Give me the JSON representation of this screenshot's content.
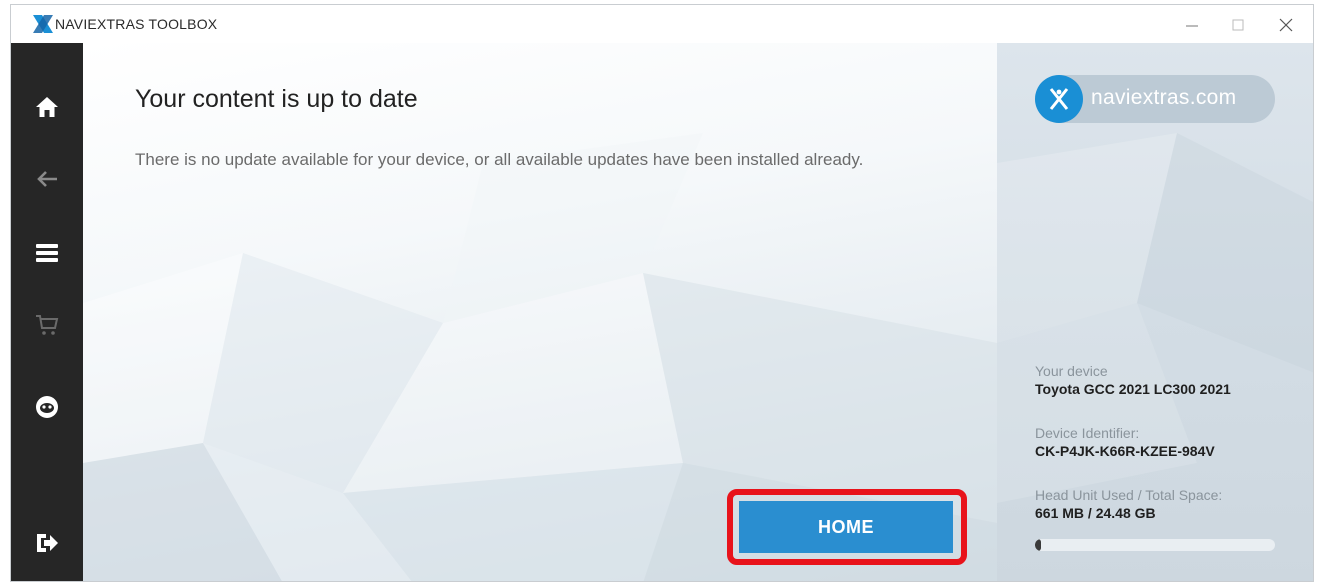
{
  "window": {
    "title": "NAVIEXTRAS TOOLBOX",
    "controls": {
      "minimize": "minimize-icon",
      "maximize": "maximize-icon",
      "close": "close-icon"
    }
  },
  "sidebar": {
    "items": [
      {
        "name": "home",
        "icon": "home-icon"
      },
      {
        "name": "back",
        "icon": "arrow-left-icon"
      },
      {
        "name": "menu",
        "icon": "menu-icon"
      },
      {
        "name": "cart",
        "icon": "cart-icon"
      },
      {
        "name": "profile",
        "icon": "face-icon"
      },
      {
        "name": "logout",
        "icon": "logout-icon"
      }
    ]
  },
  "main": {
    "heading": "Your content is up to date",
    "description": "There is no update available for your device, or all available updates have been installed already.",
    "home_button_label": "HOME"
  },
  "panel": {
    "brand_text": "naviextras.com",
    "device_label": "Your device",
    "device_value": "Toyota GCC 2021 LC300 2021",
    "identifier_label": "Device Identifier:",
    "identifier_value": "CK-P4JK-K66R-KZEE-984V",
    "space_label": "Head Unit Used / Total Space:",
    "space_value": "661 MB / 24.48 GB",
    "space_used_fraction": 0.027
  },
  "colors": {
    "accent": "#2a8ed0",
    "sidebar": "#262626",
    "highlight": "#e8131b",
    "brand": "#1a8fd5"
  }
}
